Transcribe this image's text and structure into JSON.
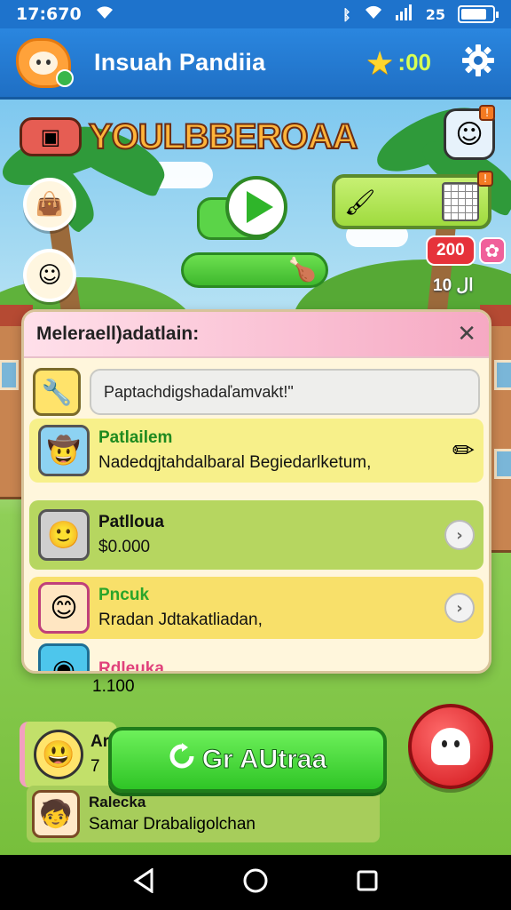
{
  "status_bar": {
    "time": "17:670",
    "right_text": "ᛔ",
    "signal_text": "25"
  },
  "header": {
    "app_title": "Insuah Pandiia",
    "coins": ":00"
  },
  "scene": {
    "game_title": "YOULBBEROAA",
    "counter": "200",
    "small_label": "10 ال"
  },
  "modal": {
    "title": "Meleraell)adatlain:",
    "search_value": "Paptachdigshadaľamvakt!\"",
    "items": [
      {
        "name": "Patlailem",
        "desc": "Nadedqjtahdalbaral Begiedarlketum,",
        "name_color": "#1f8a1f",
        "bg": "#f7f08a"
      },
      {
        "name": "Patlloua",
        "desc": "$0.000",
        "name_color": "#111111",
        "bg": "#b6d660"
      },
      {
        "name": "Pncuk",
        "desc": "Rradan Jdtakatliadan,",
        "name_color": "#2aa52a",
        "bg": "#f8e06a"
      }
    ]
  },
  "lower": [
    {
      "name": "Rdleuka",
      "desc": "1.100",
      "name_color": "#e0417b"
    },
    {
      "name": "Ar",
      "desc": "7",
      "name_color": "#111111"
    },
    {
      "name": "Ralecka",
      "desc": "Samar Drabaligolchan",
      "name_color": "#111111"
    }
  ],
  "cta": {
    "label": "Gr AUtraa",
    "icon": "refresh-icon"
  },
  "colors": {
    "header_blue": "#1f6fc4",
    "cta_green": "#2fc526",
    "fab_red": "#d2151b",
    "modal_header_pink": "#f6a9c3"
  }
}
